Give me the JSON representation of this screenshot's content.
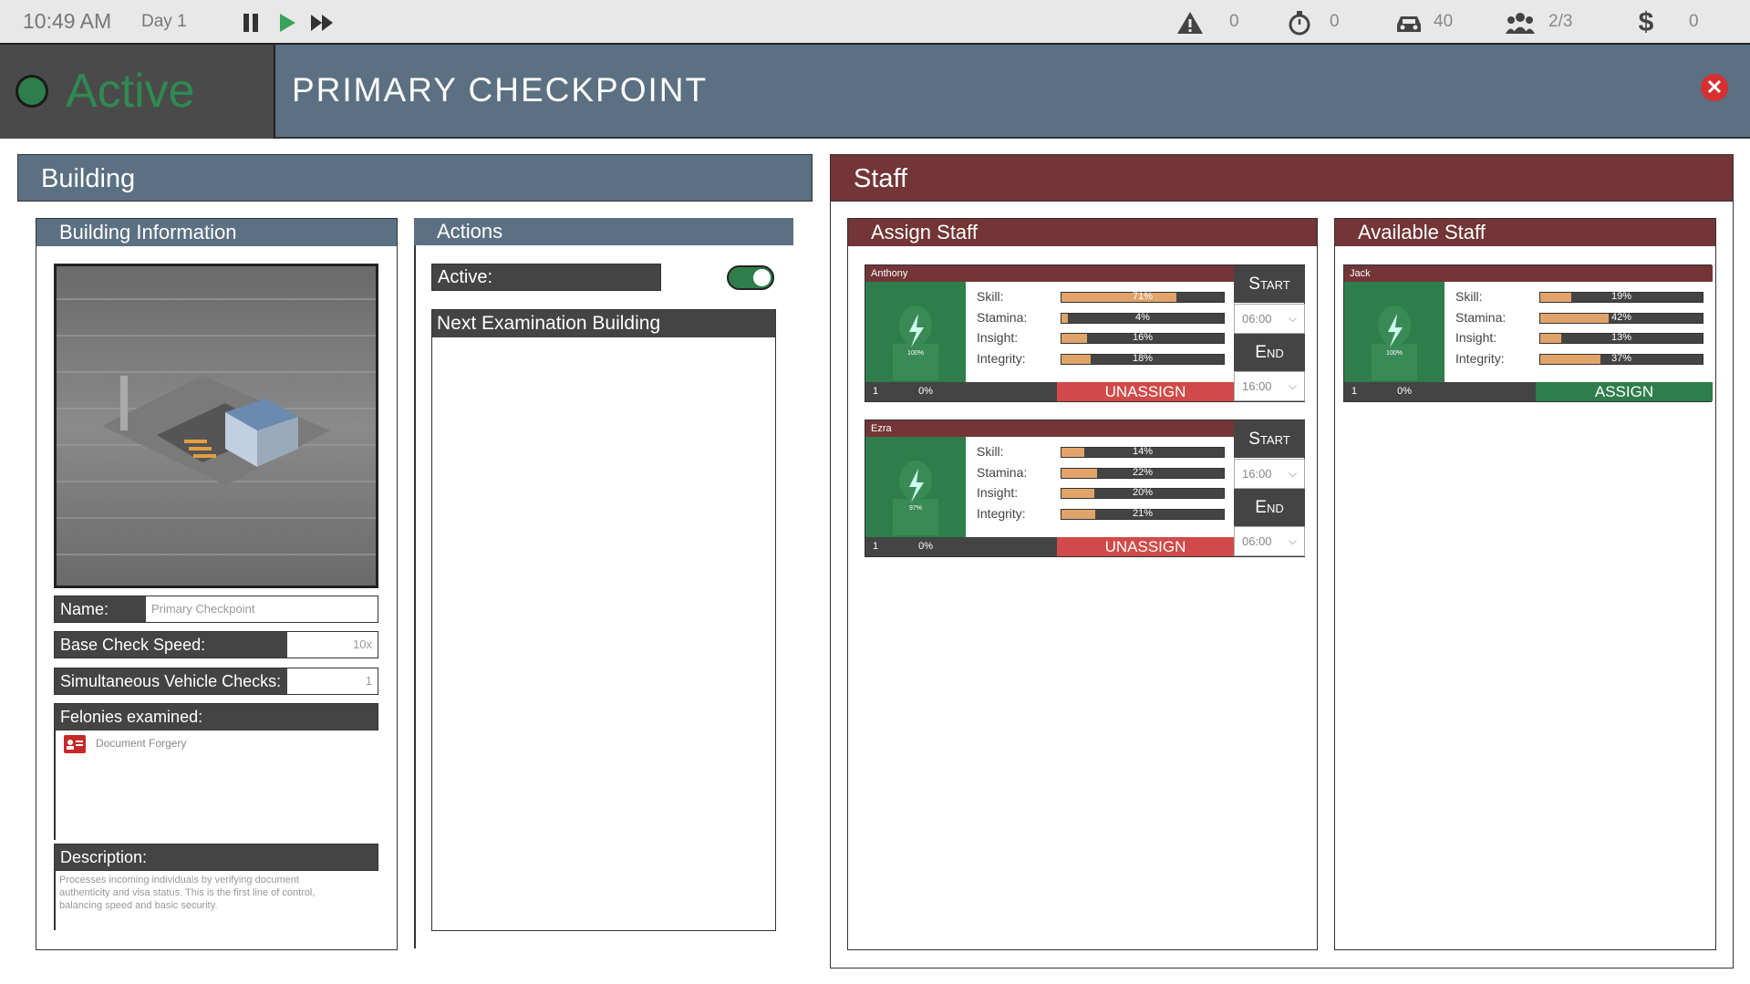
{
  "topbar": {
    "time": "10:49 AM",
    "day": "Day 1",
    "alerts": "0",
    "timer": "0",
    "vehicles": "40",
    "staff": "2/3",
    "money": "0"
  },
  "header": {
    "status": "Active",
    "title": "PRIMARY CHECKPOINT"
  },
  "building": {
    "section_title": "Building",
    "info_title": "Building Information",
    "name_label": "Name:",
    "name_value": "Primary Checkpoint",
    "speed_label": "Base Check Speed:",
    "speed_value": "10x",
    "sim_label": "Simultaneous Vehicle Checks:",
    "sim_value": "1",
    "felonies_label": "Felonies examined:",
    "felonies": [
      "Document Forgery"
    ],
    "desc_label": "Description:",
    "description": "Processes incoming individuals by verifying document authenticity and visa status. This is the first line of control, balancing speed and basic security."
  },
  "actions": {
    "title": "Actions",
    "active_label": "Active:",
    "active": true,
    "next_label": "Next Examination Building"
  },
  "staff": {
    "section_title": "Staff",
    "assign_title": "Assign Staff",
    "available_title": "Available Staff",
    "stat_labels": {
      "skill": "Skill:",
      "stamina": "Stamina:",
      "insight": "Insight:",
      "integrity": "Integrity:"
    },
    "start_label": "Start",
    "end_label": "End",
    "unassign_label": "UNASSIGN",
    "assign_label": "ASSIGN",
    "assigned": [
      {
        "name": "Anthony",
        "energy": "100%",
        "level": "1",
        "xp": "0%",
        "skill": 71,
        "skill_t": "71%",
        "stamina": 4,
        "stamina_t": "4%",
        "insight": 16,
        "insight_t": "16%",
        "integrity": 18,
        "integrity_t": "18%",
        "start": "06:00",
        "end": "16:00"
      },
      {
        "name": "Ezra",
        "energy": "97%",
        "level": "1",
        "xp": "0%",
        "skill": 14,
        "skill_t": "14%",
        "stamina": 22,
        "stamina_t": "22%",
        "insight": 20,
        "insight_t": "20%",
        "integrity": 21,
        "integrity_t": "21%",
        "start": "16:00",
        "end": "06:00"
      }
    ],
    "available": [
      {
        "name": "Jack",
        "energy": "100%",
        "level": "1",
        "xp": "0%",
        "skill": 19,
        "skill_t": "19%",
        "stamina": 42,
        "stamina_t": "42%",
        "insight": 13,
        "insight_t": "13%",
        "integrity": 37,
        "integrity_t": "37%"
      }
    ]
  }
}
